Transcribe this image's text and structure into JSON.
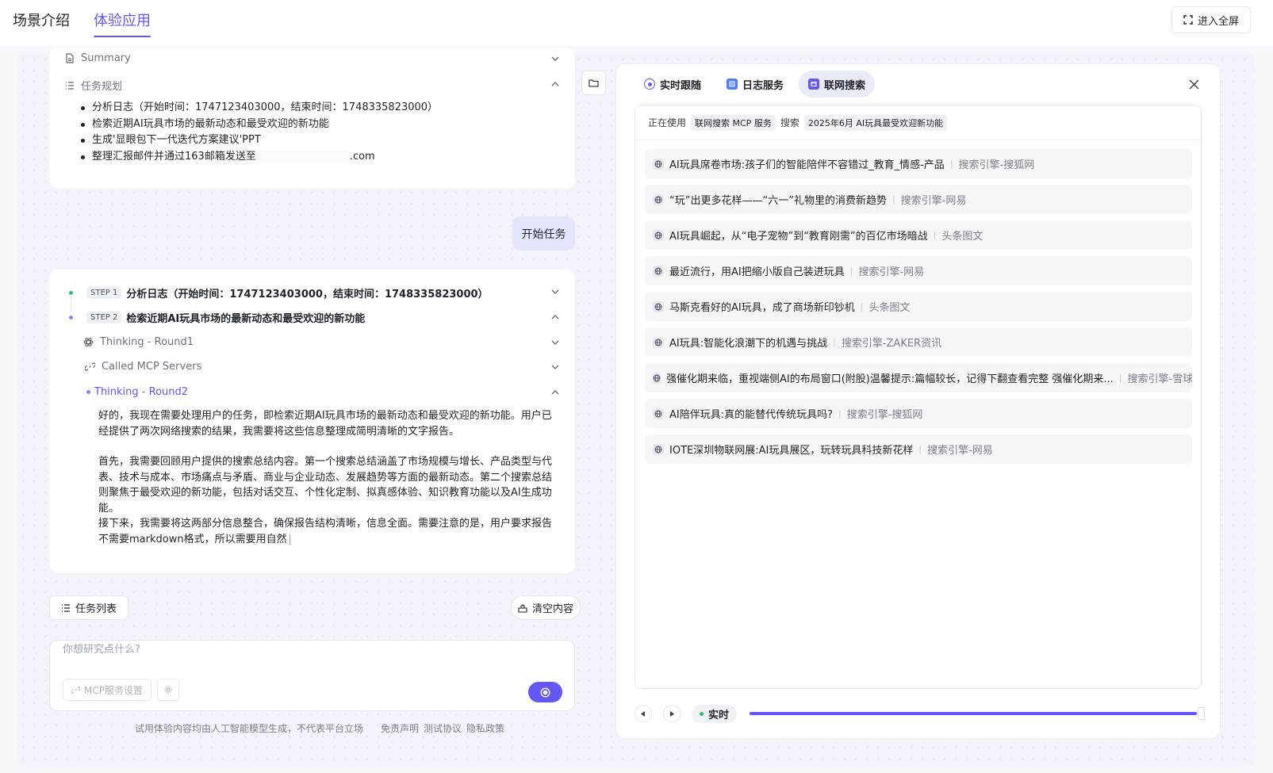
{
  "topbar": {
    "tabs": [
      {
        "label": "场景介绍",
        "active": false
      },
      {
        "label": "体验应用",
        "active": true
      }
    ],
    "fullscreen_label": "进入全屏"
  },
  "plan_card": {
    "summary_label": "Summary",
    "plan_label": "任务规划",
    "items": [
      "分析日志（开始时间：1747123403000，结束时间：1748335823000）",
      "检索近期AI玩具市场的最新动态和最受欢迎的新功能",
      "生成'显眼包下一代迭代方案建议'PPT"
    ],
    "email_prefix": "整理汇报邮件并通过163邮箱发送至",
    "email_suffix": ".com"
  },
  "user_message": "开始任务",
  "steps_card": {
    "steps": [
      {
        "badge": "STEP 1",
        "title": "分析日志（开始时间：1747123403000，结束时间：1748335823000）",
        "color": "#22c55e"
      },
      {
        "badge": "STEP 2",
        "title": "检索近期AI玩具市场的最新动态和最受欢迎的新功能",
        "color": "#8b84f5"
      }
    ],
    "substeps": {
      "thinking1": "Thinking - Round1",
      "called": "Called MCP Servers",
      "thinking2": "Thinking - Round2"
    },
    "paragraphs": [
      "好的，我现在需要处理用户的任务，即检索近期AI玩具市场的最新动态和最受欢迎的新功能。用户已经提供了两次网络搜索的结果，我需要将这些信息整理成简明清晰的文字报告。",
      "首先，我需要回顾用户提供的搜索总结内容。第一个搜索总结涵盖了市场规模与增长、产品类型与代表、技术与成本、市场痛点与矛盾、商业与企业动态、发展趋势等方面的最新动态。第二个搜索总结则聚焦于最受欢迎的新功能，包括对话交互、个性化定制、拟真感体验、知识教育功能以及AI生成功能。",
      "接下来，我需要将这两部分信息整合，确保报告结构清晰，信息全面。需要注意的是，用户要求报告不需要markdown格式，所以需要用自然"
    ]
  },
  "bottom": {
    "task_list_label": "任务列表",
    "clear_label": "清空内容",
    "input_placeholder": "你想研究点什么?",
    "mcp_settings_label": "MCP服务设置",
    "footer_notice": "试用体验内容均由人工智能模型生成，不代表平台立场",
    "footer_links": [
      "免责声明",
      "测试协议",
      "隐私政策"
    ]
  },
  "right_panel": {
    "tabs": [
      {
        "label": "实时跟随",
        "active": false
      },
      {
        "label": "日志服务",
        "active": false
      },
      {
        "label": "联网搜索",
        "active": true
      }
    ],
    "status": {
      "using_label": "正在使用",
      "service": "联网搜索 MCP 服务",
      "search_label": "搜索",
      "query": "2025年6月 AI玩具最受欢迎新功能"
    },
    "results": [
      {
        "title": "AI玩具席卷市场:孩子们的智能陪伴不容错过_教育_情感-产品",
        "source": "搜索引擎-搜狐网"
      },
      {
        "title": "“玩”出更多花样——“六一”礼物里的消费新趋势",
        "source": "搜索引擎-网易"
      },
      {
        "title": "AI玩具崛起，从“电子宠物”到“教育刚需”的百亿市场暗战",
        "source": "头条图文"
      },
      {
        "title": "最近流行，用AI把缩小版自己装进玩具",
        "source": "搜索引擎-网易"
      },
      {
        "title": "马斯克看好的AI玩具，成了商场新印钞机",
        "source": "头条图文"
      },
      {
        "title": "AI玩具:智能化浪潮下的机遇与挑战",
        "source": "搜索引擎-ZAKER资讯"
      },
      {
        "title": "强催化期来临，重视端侧AI的布局窗口(附股)温馨提示:篇幅较长，记得下翻查看完整 强催化期来...",
        "source": "搜索引擎-雪球"
      },
      {
        "title": "AI陪伴玩具:真的能替代传统玩具吗?",
        "source": "搜索引擎-搜狐网"
      },
      {
        "title": "IOTE深圳物联网展:AI玩具展区，玩转玩具科技新花样",
        "source": "搜索引擎-网易"
      }
    ],
    "live_label": "实时",
    "progress": 0.99
  },
  "colors": {
    "accent": "#6457f6",
    "live_dot": "#22c55e"
  }
}
